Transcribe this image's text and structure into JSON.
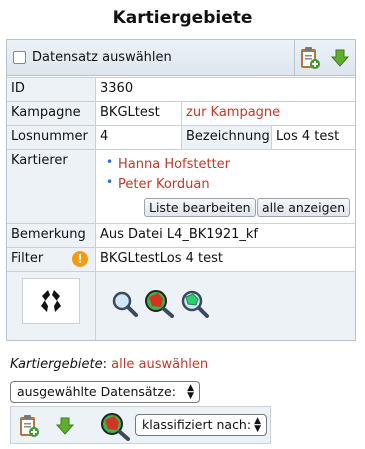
{
  "page": {
    "title": "Kartiergebiete"
  },
  "record": {
    "select_label": "Datensatz auswählen",
    "fields": {
      "id_label": "ID",
      "id_value": "3360",
      "kampagne_label": "Kampagne",
      "kampagne_value": "BKGLtest",
      "kampagne_link": "zur Kampagne",
      "losnummer_label": "Losnummer",
      "losnummer_value": "4",
      "bezeichnung_label": "Bezeichnung",
      "bezeichnung_value": "Los 4 test",
      "kartierer_label": "Kartierer",
      "kartierer": [
        "Hanna Hofstetter",
        "Peter Korduan"
      ],
      "liste_bearbeiten": "Liste bearbeiten",
      "alle_anzeigen": "alle anzeigen",
      "bemerkung_label": "Bemerkung",
      "bemerkung_value": "Aus Datei L4_BK1921_kf",
      "filter_label": "Filter",
      "filter_warn": "!",
      "filter_value": "BKGLtestLos 4 test"
    }
  },
  "section": {
    "label": "Kartiergebiete",
    "separator": ":",
    "select_all": "alle auswählen"
  },
  "controls": {
    "dataset_select": "ausgewählte Datensätze:",
    "classify_select": "klassifiziert nach:"
  },
  "icons": {
    "copy": "clipboard-plus-icon",
    "download": "download-arrow-icon",
    "zoom": "magnifier-icon",
    "zoom_red": "magnifier-red-map-icon",
    "zoom_green": "magnifier-green-map-icon",
    "preview": "geometry-preview-icon"
  }
}
